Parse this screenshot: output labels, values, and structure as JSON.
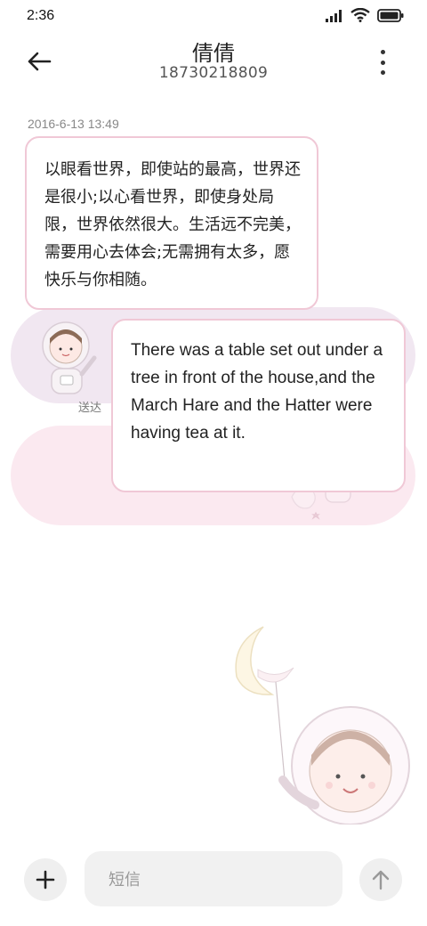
{
  "status_bar": {
    "time": "2:36",
    "icons": [
      "signal-icon",
      "wifi-icon",
      "battery-icon"
    ]
  },
  "header": {
    "contact_name": "倩倩",
    "phone_number": "18730218809",
    "icons": [
      "back-arrow-icon",
      "more-vertical-icon"
    ]
  },
  "conversation": {
    "timestamp": "2016-6-13 13:49",
    "messages": [
      {
        "direction": "incoming",
        "text": "以眼看世界，即使站的最高，世界还是很小;以心看世界，即使身处局限，世界依然很大。生活远不完美，需要用心去体会;无需拥有太多，愿快乐与你相随。"
      },
      {
        "direction": "outgoing",
        "text": "There was a table set out under a tree in front of the house,and the March Hare and the Hatter were having tea at it.",
        "status": "送达"
      }
    ]
  },
  "composer": {
    "placeholder": "短信",
    "icons": [
      "plus-icon",
      "send-arrow-icon"
    ]
  },
  "colors": {
    "bubble_border": "#f0c8d6",
    "band_lavender": "#f1e7f1",
    "band_pink": "#fbe9f0",
    "button_bg": "#efefef"
  }
}
